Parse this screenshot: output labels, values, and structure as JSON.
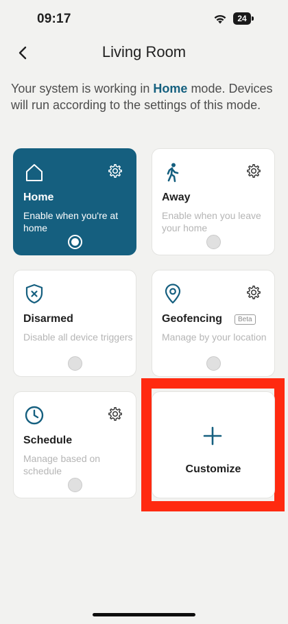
{
  "status_bar": {
    "time": "09:17",
    "battery": "24"
  },
  "header": {
    "title": "Living Room"
  },
  "description": {
    "prefix": "Your system is working in ",
    "mode": "Home",
    "suffix": " mode. Devices will run according to the settings of this mode."
  },
  "modes": [
    {
      "title": "Home",
      "description": "Enable when you're at home",
      "selected": true
    },
    {
      "title": "Away",
      "description": "Enable when you leave your home",
      "selected": false
    },
    {
      "title": "Disarmed",
      "description": "Disable all device triggers",
      "selected": false
    },
    {
      "title": "Geofencing",
      "badge": "Beta",
      "description": "Manage by your location",
      "selected": false
    },
    {
      "title": "Schedule",
      "description": "Manage based on schedule",
      "selected": false
    }
  ],
  "customize": {
    "label": "Customize"
  },
  "colors": {
    "accent": "#155f7f",
    "highlight": "#ff2a10",
    "background": "#f2f2f0"
  }
}
